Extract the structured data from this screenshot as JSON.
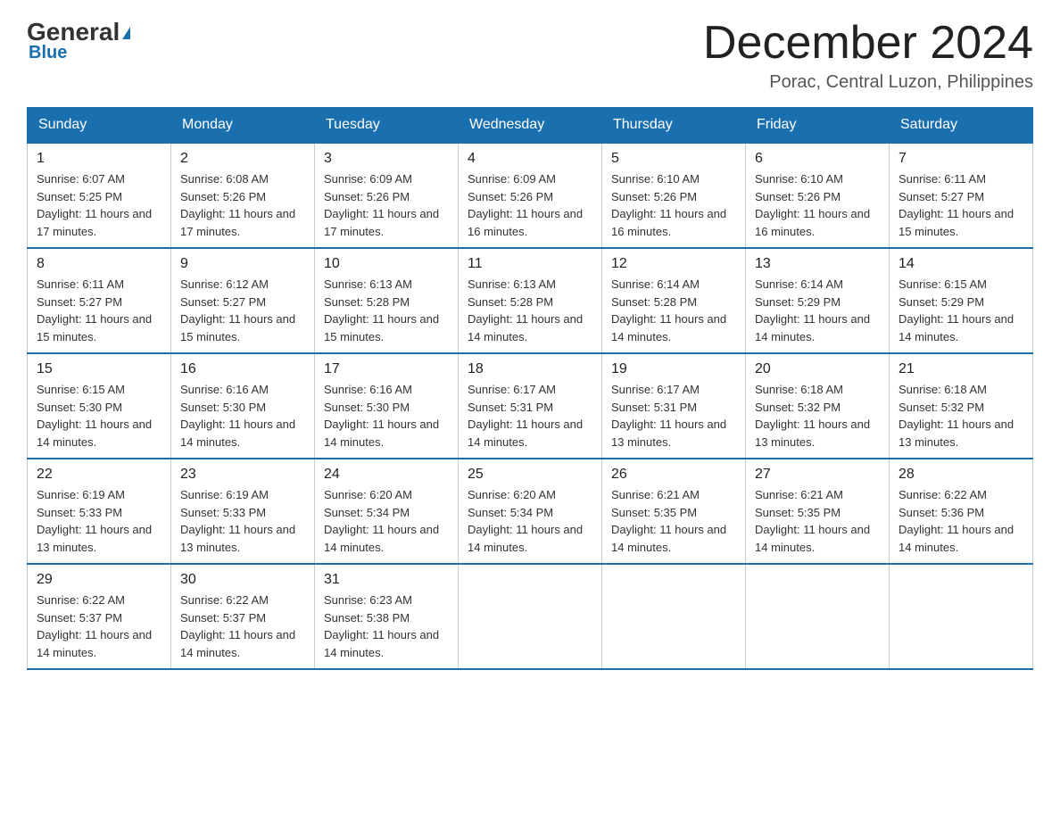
{
  "header": {
    "logo": {
      "general": "General",
      "blue": "Blue"
    },
    "title": "December 2024",
    "location": "Porac, Central Luzon, Philippines"
  },
  "calendar": {
    "days_of_week": [
      "Sunday",
      "Monday",
      "Tuesday",
      "Wednesday",
      "Thursday",
      "Friday",
      "Saturday"
    ],
    "weeks": [
      [
        {
          "day": "1",
          "sunrise": "Sunrise: 6:07 AM",
          "sunset": "Sunset: 5:25 PM",
          "daylight": "Daylight: 11 hours and 17 minutes."
        },
        {
          "day": "2",
          "sunrise": "Sunrise: 6:08 AM",
          "sunset": "Sunset: 5:26 PM",
          "daylight": "Daylight: 11 hours and 17 minutes."
        },
        {
          "day": "3",
          "sunrise": "Sunrise: 6:09 AM",
          "sunset": "Sunset: 5:26 PM",
          "daylight": "Daylight: 11 hours and 17 minutes."
        },
        {
          "day": "4",
          "sunrise": "Sunrise: 6:09 AM",
          "sunset": "Sunset: 5:26 PM",
          "daylight": "Daylight: 11 hours and 16 minutes."
        },
        {
          "day": "5",
          "sunrise": "Sunrise: 6:10 AM",
          "sunset": "Sunset: 5:26 PM",
          "daylight": "Daylight: 11 hours and 16 minutes."
        },
        {
          "day": "6",
          "sunrise": "Sunrise: 6:10 AM",
          "sunset": "Sunset: 5:26 PM",
          "daylight": "Daylight: 11 hours and 16 minutes."
        },
        {
          "day": "7",
          "sunrise": "Sunrise: 6:11 AM",
          "sunset": "Sunset: 5:27 PM",
          "daylight": "Daylight: 11 hours and 15 minutes."
        }
      ],
      [
        {
          "day": "8",
          "sunrise": "Sunrise: 6:11 AM",
          "sunset": "Sunset: 5:27 PM",
          "daylight": "Daylight: 11 hours and 15 minutes."
        },
        {
          "day": "9",
          "sunrise": "Sunrise: 6:12 AM",
          "sunset": "Sunset: 5:27 PM",
          "daylight": "Daylight: 11 hours and 15 minutes."
        },
        {
          "day": "10",
          "sunrise": "Sunrise: 6:13 AM",
          "sunset": "Sunset: 5:28 PM",
          "daylight": "Daylight: 11 hours and 15 minutes."
        },
        {
          "day": "11",
          "sunrise": "Sunrise: 6:13 AM",
          "sunset": "Sunset: 5:28 PM",
          "daylight": "Daylight: 11 hours and 14 minutes."
        },
        {
          "day": "12",
          "sunrise": "Sunrise: 6:14 AM",
          "sunset": "Sunset: 5:28 PM",
          "daylight": "Daylight: 11 hours and 14 minutes."
        },
        {
          "day": "13",
          "sunrise": "Sunrise: 6:14 AM",
          "sunset": "Sunset: 5:29 PM",
          "daylight": "Daylight: 11 hours and 14 minutes."
        },
        {
          "day": "14",
          "sunrise": "Sunrise: 6:15 AM",
          "sunset": "Sunset: 5:29 PM",
          "daylight": "Daylight: 11 hours and 14 minutes."
        }
      ],
      [
        {
          "day": "15",
          "sunrise": "Sunrise: 6:15 AM",
          "sunset": "Sunset: 5:30 PM",
          "daylight": "Daylight: 11 hours and 14 minutes."
        },
        {
          "day": "16",
          "sunrise": "Sunrise: 6:16 AM",
          "sunset": "Sunset: 5:30 PM",
          "daylight": "Daylight: 11 hours and 14 minutes."
        },
        {
          "day": "17",
          "sunrise": "Sunrise: 6:16 AM",
          "sunset": "Sunset: 5:30 PM",
          "daylight": "Daylight: 11 hours and 14 minutes."
        },
        {
          "day": "18",
          "sunrise": "Sunrise: 6:17 AM",
          "sunset": "Sunset: 5:31 PM",
          "daylight": "Daylight: 11 hours and 14 minutes."
        },
        {
          "day": "19",
          "sunrise": "Sunrise: 6:17 AM",
          "sunset": "Sunset: 5:31 PM",
          "daylight": "Daylight: 11 hours and 13 minutes."
        },
        {
          "day": "20",
          "sunrise": "Sunrise: 6:18 AM",
          "sunset": "Sunset: 5:32 PM",
          "daylight": "Daylight: 11 hours and 13 minutes."
        },
        {
          "day": "21",
          "sunrise": "Sunrise: 6:18 AM",
          "sunset": "Sunset: 5:32 PM",
          "daylight": "Daylight: 11 hours and 13 minutes."
        }
      ],
      [
        {
          "day": "22",
          "sunrise": "Sunrise: 6:19 AM",
          "sunset": "Sunset: 5:33 PM",
          "daylight": "Daylight: 11 hours and 13 minutes."
        },
        {
          "day": "23",
          "sunrise": "Sunrise: 6:19 AM",
          "sunset": "Sunset: 5:33 PM",
          "daylight": "Daylight: 11 hours and 13 minutes."
        },
        {
          "day": "24",
          "sunrise": "Sunrise: 6:20 AM",
          "sunset": "Sunset: 5:34 PM",
          "daylight": "Daylight: 11 hours and 14 minutes."
        },
        {
          "day": "25",
          "sunrise": "Sunrise: 6:20 AM",
          "sunset": "Sunset: 5:34 PM",
          "daylight": "Daylight: 11 hours and 14 minutes."
        },
        {
          "day": "26",
          "sunrise": "Sunrise: 6:21 AM",
          "sunset": "Sunset: 5:35 PM",
          "daylight": "Daylight: 11 hours and 14 minutes."
        },
        {
          "day": "27",
          "sunrise": "Sunrise: 6:21 AM",
          "sunset": "Sunset: 5:35 PM",
          "daylight": "Daylight: 11 hours and 14 minutes."
        },
        {
          "day": "28",
          "sunrise": "Sunrise: 6:22 AM",
          "sunset": "Sunset: 5:36 PM",
          "daylight": "Daylight: 11 hours and 14 minutes."
        }
      ],
      [
        {
          "day": "29",
          "sunrise": "Sunrise: 6:22 AM",
          "sunset": "Sunset: 5:37 PM",
          "daylight": "Daylight: 11 hours and 14 minutes."
        },
        {
          "day": "30",
          "sunrise": "Sunrise: 6:22 AM",
          "sunset": "Sunset: 5:37 PM",
          "daylight": "Daylight: 11 hours and 14 minutes."
        },
        {
          "day": "31",
          "sunrise": "Sunrise: 6:23 AM",
          "sunset": "Sunset: 5:38 PM",
          "daylight": "Daylight: 11 hours and 14 minutes."
        },
        null,
        null,
        null,
        null
      ]
    ]
  }
}
